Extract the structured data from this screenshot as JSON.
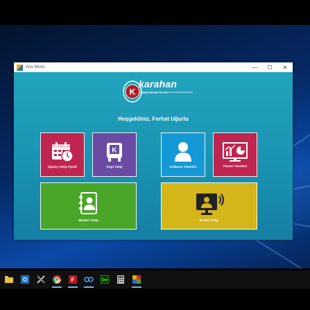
{
  "window": {
    "title": "Ana Menü",
    "minimize": "—",
    "maximize": "☐",
    "close": "✕"
  },
  "logo": {
    "brand": "karahan",
    "subtitle": "Tekstil ve Dış Tic. A.Ş.",
    "mark_letter": "K"
  },
  "welcome": "Hoşgeldiniz, Ferhat Uğurlu",
  "tiles": [
    {
      "label": "Sipariş Takip Paneli",
      "icon": "calendar-clock-icon",
      "color": "#c0254f"
    },
    {
      "label": "Örgü Takip",
      "icon": "knitting-machine-icon",
      "color": "#6a4aa3"
    },
    {
      "label": "Kullanıcı Yönetimi",
      "icon": "user-icon",
      "color": "#1599d6"
    },
    {
      "label": "Finans Yönetimi",
      "icon": "finance-chart-icon",
      "color": "#c0254f"
    },
    {
      "label": "Müşteri Takip",
      "icon": "contacts-book-icon",
      "color": "#4aa629"
    },
    {
      "label": "Durum Takip",
      "icon": "presentation-user-icon",
      "color": "#d4b51a"
    }
  ],
  "taskbar": [
    {
      "icon": "file-explorer-icon"
    },
    {
      "icon": "outlook-icon"
    },
    {
      "icon": "tools-icon"
    },
    {
      "icon": "chrome-icon"
    },
    {
      "icon": "filezilla-icon"
    },
    {
      "icon": "link-app-icon"
    },
    {
      "icon": "dreamweaver-icon"
    },
    {
      "icon": "calculator-icon"
    },
    {
      "icon": "karahan-app-icon"
    }
  ],
  "colors": {
    "client_bg": "#1a93b2",
    "desktop_bg": "#062a66",
    "taskbar_bg": "#101010"
  }
}
